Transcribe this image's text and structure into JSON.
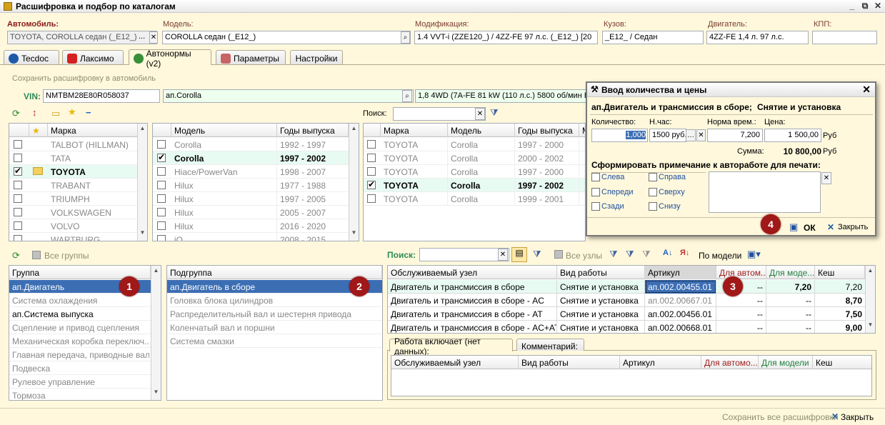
{
  "window": {
    "title": "Расшифровка и подбор по каталогам",
    "minimize": "_",
    "restore": "⧉",
    "close": "✕"
  },
  "header": {
    "auto_label": "Автомобиль:",
    "auto_value": "TOYOTA, COROLLA седан (_E12_)",
    "auto_btn": "...",
    "model_label": "Модель:",
    "model_value": "COROLLA седан (_E12_)",
    "mod_label": "Модификация:",
    "mod_value": "1.4 VVT-i (ZZE120_) / 4ZZ-FE 97 л.с. (_E12_) [20",
    "body_label": "Кузов:",
    "body_value": "_E12_ / Седан",
    "engine_label": "Двигатель:",
    "engine_value": "4ZZ-FE 1,4 л. 97 л.с.",
    "kpp_label": "КПП:",
    "kpp_value": ""
  },
  "tabs": [
    {
      "label": "Tecdoc"
    },
    {
      "label": "Лаксимо"
    },
    {
      "label": "Автонормы (v2)"
    },
    {
      "label": "Параметры"
    },
    {
      "label": "Настройки"
    }
  ],
  "vin_section": {
    "save_link": "Сохранить расшифровку в автомобиль",
    "vin_label": "VIN:",
    "vin_value": "NMTBM28E80R058037",
    "model_value": "ап.Corolla",
    "desc_value": "1,8 4WD (7A-FE 81 kW (110 л.с.) 5800 об/мин E",
    "search_label": "Поиск:"
  },
  "brand_grid": {
    "headers": [
      "Марка"
    ],
    "rows": [
      {
        "name": "TALBOT (HILLMAN)",
        "checked": false
      },
      {
        "name": "TATA",
        "checked": false
      },
      {
        "name": "TOYOTA",
        "checked": true
      },
      {
        "name": "TRABANT",
        "checked": false
      },
      {
        "name": "TRIUMPH",
        "checked": false
      },
      {
        "name": "VOLKSWAGEN",
        "checked": false
      },
      {
        "name": "VOLVO",
        "checked": false
      },
      {
        "name": "WARTBURG",
        "checked": false
      }
    ]
  },
  "model_grid": {
    "headers": [
      "Модель",
      "Годы выпуска"
    ],
    "rows": [
      {
        "model": "Corolla",
        "years": "1992 - 1997",
        "checked": false
      },
      {
        "model": "Corolla",
        "years": "1997 - 2002",
        "checked": true
      },
      {
        "model": "Hiace/PowerVan",
        "years": "1998 - 2007",
        "checked": false
      },
      {
        "model": "Hilux",
        "years": "1977 - 1988",
        "checked": false
      },
      {
        "model": "Hilux",
        "years": "1997 - 2005",
        "checked": false
      },
      {
        "model": "Hilux",
        "years": "2005 - 2007",
        "checked": false
      },
      {
        "model": "Hilux",
        "years": "2016 - 2020",
        "checked": false
      },
      {
        "model": "iQ",
        "years": "2008 - 2015",
        "checked": false
      }
    ]
  },
  "result_grid": {
    "headers": [
      "Марка",
      "Модель",
      "Годы выпуска",
      "М"
    ],
    "rows": [
      {
        "brand": "TOYOTA",
        "model": "Corolla",
        "years": "1997 - 2000",
        "checked": false
      },
      {
        "brand": "TOYOTA",
        "model": "Corolla",
        "years": "2000 - 2002",
        "checked": false
      },
      {
        "brand": "TOYOTA",
        "model": "Corolla",
        "years": "1997 - 2000",
        "checked": false
      },
      {
        "brand": "TOYOTA",
        "model": "Corolla",
        "years": "1997 - 2002",
        "checked": true
      },
      {
        "brand": "TOYOTA",
        "model": "Corolla",
        "years": "1999 - 2001",
        "checked": false
      }
    ]
  },
  "groups_toolbar": {
    "all_groups": "Все группы",
    "search_label": "Поиск:",
    "all_nodes": "Все узлы",
    "by_model": "По модели"
  },
  "group_grid": {
    "header": "Группа",
    "rows": [
      {
        "name": "ап.Двигатель",
        "active": true
      },
      {
        "name": "Система охлаждения",
        "active": false
      },
      {
        "name": "ап.Система выпуска",
        "active": true
      },
      {
        "name": "Сцепление и привод сцепления",
        "active": false
      },
      {
        "name": "Механическая коробка переключ...",
        "active": false
      },
      {
        "name": "Главная передача, приводные валы...",
        "active": false
      },
      {
        "name": "Подвеска",
        "active": false
      },
      {
        "name": "Рулевое управление",
        "active": false
      },
      {
        "name": "Тормоза",
        "active": false
      }
    ]
  },
  "subgroup_grid": {
    "header": "Подгруппа",
    "rows": [
      "ап.Двигатель в сборе",
      "Головка блока цилиндров",
      "Распределительный вал и шестерня привода",
      "Коленчатый вал и поршни",
      "Система смазки"
    ]
  },
  "works_grid": {
    "headers": [
      "Обслуживаемый узел",
      "Вид работы",
      "Артикул",
      "Для автом...",
      "Для моде...",
      "Кеш"
    ],
    "rows": [
      {
        "node": "Двигатель и трансмиссия в сборе",
        "work": "Снятие и установка",
        "article": "ап.002.00455.01",
        "auto": "--",
        "model": "7,20",
        "cache": "7,20"
      },
      {
        "node": "Двигатель и трансмиссия в сборе - AC",
        "work": "Снятие и установка",
        "article": "ап.002.00667.01",
        "auto": "--",
        "model": "--",
        "cache": "8,70"
      },
      {
        "node": "Двигатель и трансмиссия в сборе - AT",
        "work": "Снятие и установка",
        "article": "ап.002.00456.01",
        "auto": "--",
        "model": "--",
        "cache": "7,50"
      },
      {
        "node": "Двигатель и трансмиссия в сборе - AC+AT",
        "work": "Снятие и установка",
        "article": "ап.002.00668.01",
        "auto": "--",
        "model": "--",
        "cache": "9,00"
      }
    ]
  },
  "bottom_tabs": {
    "tab1": "Работа включает (нет данных):",
    "tab2": "Комментарий:",
    "headers": [
      "Обслуживаемый узел",
      "Вид работы",
      "Артикул",
      "Для автомо...",
      "Для модели ...",
      "Кеш"
    ]
  },
  "dialog": {
    "title": "Ввод количества и цены",
    "subtitle_node": "ап.Двигатель и трансмиссия в сборе;",
    "subtitle_work": "Снятие и установка",
    "qty_label": "Количество:",
    "qty_value": "1,000",
    "nh_label": "Н.час:",
    "nh_value": "1500 руб.",
    "norm_label": "Норма врем.:",
    "norm_value": "7,200",
    "price_label": "Цена:",
    "price_value": "1 500,00",
    "currency": "Руб",
    "sum_label": "Сумма:",
    "sum_value": "10 800,00",
    "sum_currency": "Руб",
    "note_title": "Сформировать примечание к автоработе для печати:",
    "opt_left": "Слева",
    "opt_right": "Справа",
    "opt_front": "Спереди",
    "opt_top": "Сверху",
    "opt_back": "Сзади",
    "opt_bottom": "Снизу",
    "ok_label": "ОК",
    "close_label": "Закрыть"
  },
  "markers": [
    "1",
    "2",
    "3",
    "4"
  ],
  "footer": {
    "save_all": "Сохранить все расшифровки",
    "close": "Закрыть"
  }
}
